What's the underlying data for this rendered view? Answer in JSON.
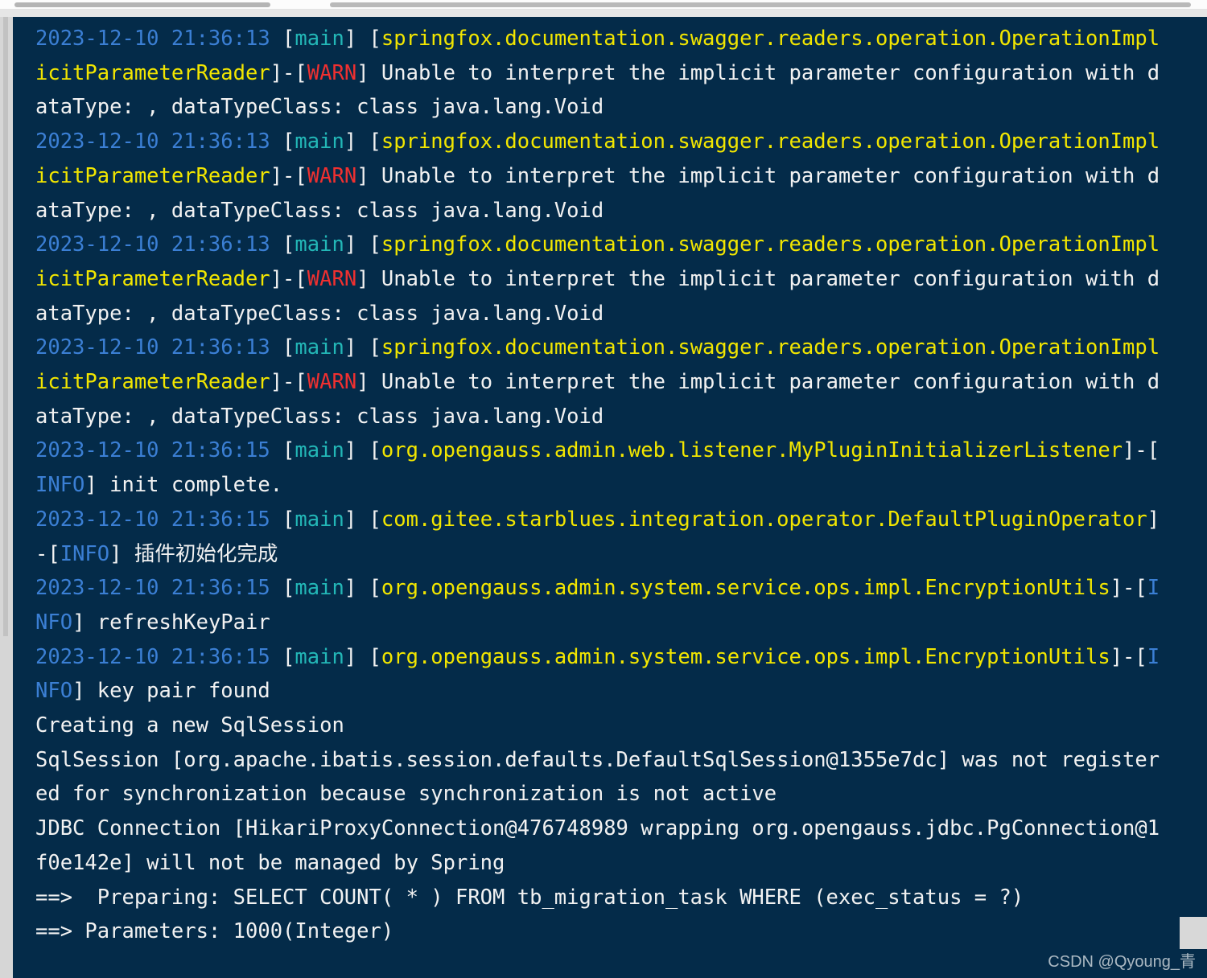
{
  "window": {
    "kind": "ide-console-log-viewer",
    "background_color": "#042b49",
    "colors": {
      "timestamp": "#3b7fd4",
      "thread": "#23b7b7",
      "logger": "#f2e600",
      "warn": "#f03030",
      "info": "#3b7fd4",
      "text": "#f2f2f2",
      "scrollbar_track": "#fcfcfc",
      "scrollbar_thumb": "#b4b4b4",
      "gutter": "#d6d6d6"
    }
  },
  "scrollbar": {
    "horizontal_left_thumb_label": "horizontal-scroll-thumb-left",
    "horizontal_right_thumb_label": "horizontal-scroll-thumb-right",
    "vertical_thumb_label": "vertical-scroll-thumb"
  },
  "watermark": {
    "text": "CSDN @Qyoung_青"
  },
  "console": {
    "lines": [
      {
        "id": 0,
        "segments": [
          {
            "cls": "c-time",
            "text": "2023-12-10 21:36:13 "
          },
          {
            "cls": "c-white",
            "text": "["
          },
          {
            "cls": "c-thread",
            "text": "main"
          },
          {
            "cls": "c-white",
            "text": "] ["
          },
          {
            "cls": "c-logger",
            "text": "springfox.documentation.swagger.readers.operation.OperationImpl"
          }
        ]
      },
      {
        "id": 1,
        "segments": [
          {
            "cls": "c-logger",
            "text": "icitParameterReader"
          },
          {
            "cls": "c-white",
            "text": "]-["
          },
          {
            "cls": "c-warn",
            "text": "WARN"
          },
          {
            "cls": "c-white",
            "text": "] Unable to interpret the implicit parameter configuration with d"
          }
        ]
      },
      {
        "id": 2,
        "segments": [
          {
            "cls": "c-white",
            "text": "ataType: , dataTypeClass: class java.lang.Void"
          }
        ]
      },
      {
        "id": 3,
        "segments": [
          {
            "cls": "c-time",
            "text": "2023-12-10 21:36:13 "
          },
          {
            "cls": "c-white",
            "text": "["
          },
          {
            "cls": "c-thread",
            "text": "main"
          },
          {
            "cls": "c-white",
            "text": "] ["
          },
          {
            "cls": "c-logger",
            "text": "springfox.documentation.swagger.readers.operation.OperationImpl"
          }
        ]
      },
      {
        "id": 4,
        "segments": [
          {
            "cls": "c-logger",
            "text": "icitParameterReader"
          },
          {
            "cls": "c-white",
            "text": "]-["
          },
          {
            "cls": "c-warn",
            "text": "WARN"
          },
          {
            "cls": "c-white",
            "text": "] Unable to interpret the implicit parameter configuration with d"
          }
        ]
      },
      {
        "id": 5,
        "segments": [
          {
            "cls": "c-white",
            "text": "ataType: , dataTypeClass: class java.lang.Void"
          }
        ]
      },
      {
        "id": 6,
        "segments": [
          {
            "cls": "c-time",
            "text": "2023-12-10 21:36:13 "
          },
          {
            "cls": "c-white",
            "text": "["
          },
          {
            "cls": "c-thread",
            "text": "main"
          },
          {
            "cls": "c-white",
            "text": "] ["
          },
          {
            "cls": "c-logger",
            "text": "springfox.documentation.swagger.readers.operation.OperationImpl"
          }
        ]
      },
      {
        "id": 7,
        "segments": [
          {
            "cls": "c-logger",
            "text": "icitParameterReader"
          },
          {
            "cls": "c-white",
            "text": "]-["
          },
          {
            "cls": "c-warn",
            "text": "WARN"
          },
          {
            "cls": "c-white",
            "text": "] Unable to interpret the implicit parameter configuration with d"
          }
        ]
      },
      {
        "id": 8,
        "segments": [
          {
            "cls": "c-white",
            "text": "ataType: , dataTypeClass: class java.lang.Void"
          }
        ]
      },
      {
        "id": 9,
        "segments": [
          {
            "cls": "c-time",
            "text": "2023-12-10 21:36:13 "
          },
          {
            "cls": "c-white",
            "text": "["
          },
          {
            "cls": "c-thread",
            "text": "main"
          },
          {
            "cls": "c-white",
            "text": "] ["
          },
          {
            "cls": "c-logger",
            "text": "springfox.documentation.swagger.readers.operation.OperationImpl"
          }
        ]
      },
      {
        "id": 10,
        "segments": [
          {
            "cls": "c-logger",
            "text": "icitParameterReader"
          },
          {
            "cls": "c-white",
            "text": "]-["
          },
          {
            "cls": "c-warn",
            "text": "WARN"
          },
          {
            "cls": "c-white",
            "text": "] Unable to interpret the implicit parameter configuration with d"
          }
        ]
      },
      {
        "id": 11,
        "segments": [
          {
            "cls": "c-white",
            "text": "ataType: , dataTypeClass: class java.lang.Void"
          }
        ]
      },
      {
        "id": 12,
        "segments": [
          {
            "cls": "c-time",
            "text": "2023-12-10 21:36:15 "
          },
          {
            "cls": "c-white",
            "text": "["
          },
          {
            "cls": "c-thread",
            "text": "main"
          },
          {
            "cls": "c-white",
            "text": "] ["
          },
          {
            "cls": "c-logger",
            "text": "org.opengauss.admin.web.listener.MyPluginInitializerListener"
          },
          {
            "cls": "c-white",
            "text": "]-["
          }
        ]
      },
      {
        "id": 13,
        "segments": [
          {
            "cls": "c-info",
            "text": "INFO"
          },
          {
            "cls": "c-white",
            "text": "] init complete."
          }
        ]
      },
      {
        "id": 14,
        "segments": [
          {
            "cls": "c-time",
            "text": "2023-12-10 21:36:15 "
          },
          {
            "cls": "c-white",
            "text": "["
          },
          {
            "cls": "c-thread",
            "text": "main"
          },
          {
            "cls": "c-white",
            "text": "] ["
          },
          {
            "cls": "c-logger",
            "text": "com.gitee.starblues.integration.operator.DefaultPluginOperator"
          },
          {
            "cls": "c-white",
            "text": "]"
          }
        ]
      },
      {
        "id": 15,
        "segments": [
          {
            "cls": "c-white",
            "text": "-["
          },
          {
            "cls": "c-info",
            "text": "INFO"
          },
          {
            "cls": "c-white",
            "text": "] "
          },
          {
            "cls": "c-white cjk",
            "text": "插件初始化完成"
          }
        ]
      },
      {
        "id": 16,
        "segments": [
          {
            "cls": "c-time",
            "text": "2023-12-10 21:36:15 "
          },
          {
            "cls": "c-white",
            "text": "["
          },
          {
            "cls": "c-thread",
            "text": "main"
          },
          {
            "cls": "c-white",
            "text": "] ["
          },
          {
            "cls": "c-logger",
            "text": "org.opengauss.admin.system.service.ops.impl.EncryptionUtils"
          },
          {
            "cls": "c-white",
            "text": "]-["
          },
          {
            "cls": "c-info",
            "text": "I"
          }
        ]
      },
      {
        "id": 17,
        "segments": [
          {
            "cls": "c-info",
            "text": "NFO"
          },
          {
            "cls": "c-white",
            "text": "] refreshKeyPair"
          }
        ]
      },
      {
        "id": 18,
        "segments": [
          {
            "cls": "c-time",
            "text": "2023-12-10 21:36:15 "
          },
          {
            "cls": "c-white",
            "text": "["
          },
          {
            "cls": "c-thread",
            "text": "main"
          },
          {
            "cls": "c-white",
            "text": "] ["
          },
          {
            "cls": "c-logger",
            "text": "org.opengauss.admin.system.service.ops.impl.EncryptionUtils"
          },
          {
            "cls": "c-white",
            "text": "]-["
          },
          {
            "cls": "c-info",
            "text": "I"
          }
        ]
      },
      {
        "id": 19,
        "segments": [
          {
            "cls": "c-info",
            "text": "NFO"
          },
          {
            "cls": "c-white",
            "text": "] key pair found"
          }
        ]
      },
      {
        "id": 20,
        "segments": [
          {
            "cls": "c-white",
            "text": "Creating a new SqlSession"
          }
        ]
      },
      {
        "id": 21,
        "segments": [
          {
            "cls": "c-white",
            "text": "SqlSession [org.apache.ibatis.session.defaults.DefaultSqlSession@1355e7dc] was not register"
          }
        ]
      },
      {
        "id": 22,
        "segments": [
          {
            "cls": "c-white",
            "text": "ed for synchronization because synchronization is not active"
          }
        ]
      },
      {
        "id": 23,
        "segments": [
          {
            "cls": "c-white",
            "text": "JDBC Connection [HikariProxyConnection@476748989 wrapping org.opengauss.jdbc.PgConnection@1"
          }
        ]
      },
      {
        "id": 24,
        "segments": [
          {
            "cls": "c-white",
            "text": "f0e142e] will not be managed by Spring"
          }
        ]
      },
      {
        "id": 25,
        "segments": [
          {
            "cls": "c-white",
            "text": "==>  Preparing: SELECT COUNT( * ) FROM tb_migration_task WHERE (exec_status = ?)"
          }
        ]
      },
      {
        "id": 26,
        "segments": [
          {
            "cls": "c-white",
            "text": "==> Parameters: 1000(Integer)"
          }
        ]
      }
    ]
  }
}
